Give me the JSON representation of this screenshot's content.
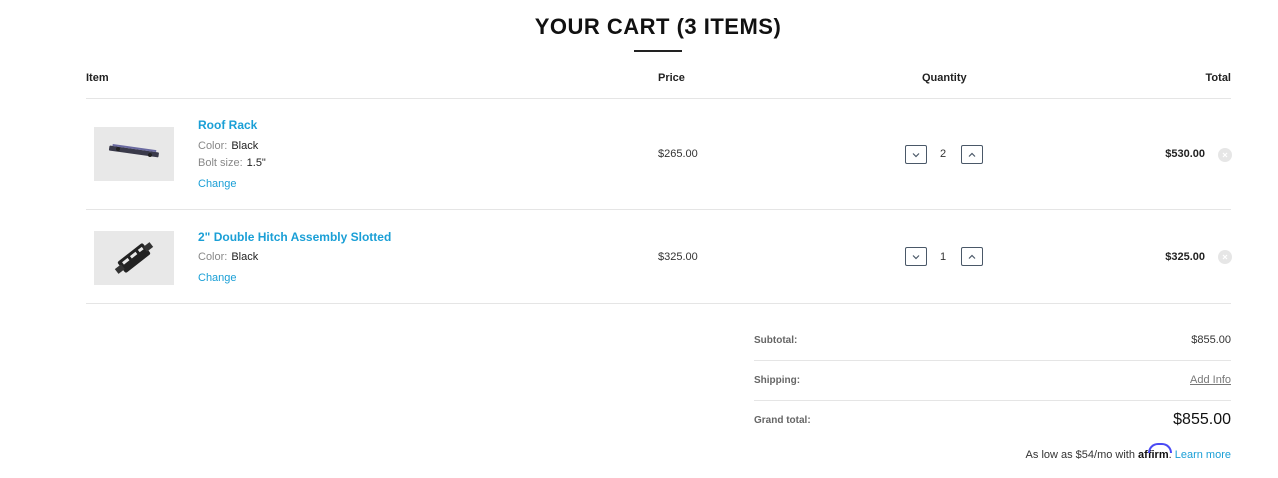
{
  "title": "YOUR CART (3 ITEMS)",
  "columns": {
    "item": "Item",
    "price": "Price",
    "quantity": "Quantity",
    "total": "Total"
  },
  "items": [
    {
      "name": "Roof Rack",
      "attributes": [
        {
          "label": "Color:",
          "value": "Black"
        },
        {
          "label": "Bolt size:",
          "value": "1.5\""
        }
      ],
      "change": "Change",
      "price": "$265.00",
      "quantity": "2",
      "total": "$530.00",
      "image_icon": "roof-rack-image"
    },
    {
      "name": "2\" Double Hitch Assembly Slotted",
      "attributes": [
        {
          "label": "Color:",
          "value": "Black"
        }
      ],
      "change": "Change",
      "price": "$325.00",
      "quantity": "1",
      "total": "$325.00",
      "image_icon": "hitch-assembly-image"
    }
  ],
  "summary": {
    "subtotal_label": "Subtotal:",
    "subtotal_value": "$855.00",
    "shipping_label": "Shipping:",
    "shipping_value": "Add Info",
    "grand_total_label": "Grand total:",
    "grand_total_value": "$855.00"
  },
  "financing": {
    "prefix": "As low as $54/mo with",
    "brand": "affirm",
    "suffix": ".",
    "link": "Learn more"
  },
  "colors": {
    "link": "#1a9fd6",
    "button_border": "#4a5868",
    "divider": "#e5e5e5",
    "affirm_arc": "#4a4af4"
  }
}
